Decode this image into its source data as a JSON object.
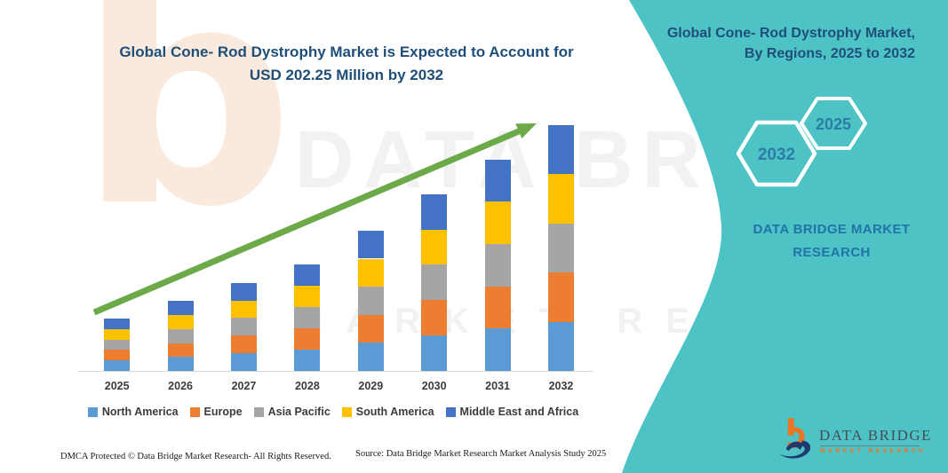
{
  "title": {
    "line1": "Global Cone- Rod Dystrophy Market is Expected to Account for",
    "line2": "USD 202.25 Million by 2032"
  },
  "right_panel": {
    "heading_line1": "Global Cone- Rod Dystrophy Market,",
    "heading_line2": "By Regions, 2025 to 2032",
    "hexagons": [
      {
        "label": "2032"
      },
      {
        "label": "2025"
      }
    ],
    "brand_line1": "DATA BRIDGE MARKET",
    "brand_line2": "RESEARCH"
  },
  "watermarks": {
    "b_glyph": "b",
    "big_text": "DATA BRIDGE",
    "sub_text": "MARKET RESEARCH"
  },
  "chart_data": {
    "type": "bar",
    "stacked": true,
    "title": "Global Cone- Rod Dystrophy Market is Expected to Account for USD 202.25 Million by 2032",
    "unit": "USD Million",
    "categories": [
      "2025",
      "2026",
      "2027",
      "2028",
      "2029",
      "2030",
      "2031",
      "2032"
    ],
    "series": [
      {
        "name": "North America",
        "color": "#5B9BD5",
        "values": [
          8.6,
          11.5,
          14.5,
          17.5,
          23.1,
          29.1,
          34.8,
          40.5
        ]
      },
      {
        "name": "Europe",
        "color": "#ED7D31",
        "values": [
          8.6,
          11.5,
          14.5,
          17.5,
          23.1,
          29.1,
          34.8,
          40.5
        ]
      },
      {
        "name": "Asia Pacific",
        "color": "#A5A5A5",
        "values": [
          8.6,
          11.5,
          14.5,
          17.5,
          23.1,
          29.1,
          34.8,
          40.5
        ]
      },
      {
        "name": "South America",
        "color": "#FFC000",
        "values": [
          8.6,
          11.5,
          14.5,
          17.5,
          23.1,
          29.1,
          34.8,
          40.5
        ]
      },
      {
        "name": "Middle East and Africa",
        "color": "#4472C4",
        "values": [
          8.6,
          11.5,
          14.5,
          17.5,
          23.1,
          29.1,
          34.8,
          40.25
        ]
      }
    ],
    "totals": [
      43.0,
      57.5,
      72.5,
      87.5,
      115.5,
      145.5,
      174.0,
      202.25
    ],
    "xlabel": "",
    "ylabel": "",
    "ylim": [
      0,
      210
    ],
    "grid": false,
    "legend_position": "bottom",
    "trend_arrow": true,
    "arrow_color": "#6CA948"
  },
  "footer": {
    "dmca": "DMCA Protected © Data Bridge Market Research-  All Rights Reserved.",
    "source": "Source: Data Bridge Market Research  Market Analysis Study 2025"
  },
  "logo": {
    "line1": "DATA BRIDGE",
    "line2": "MARKET RESEARCH"
  },
  "colors": {
    "panel_teal": "#4EC3C5",
    "title_blue": "#1F4E79",
    "brand_blue": "#2273A8",
    "hexagon_text": "#2B7DA6",
    "axis_gray": "#D9D9D9",
    "label_gray": "#3B3B3B",
    "logo_orange": "#E87725",
    "logo_navy": "#1E3A6E"
  }
}
